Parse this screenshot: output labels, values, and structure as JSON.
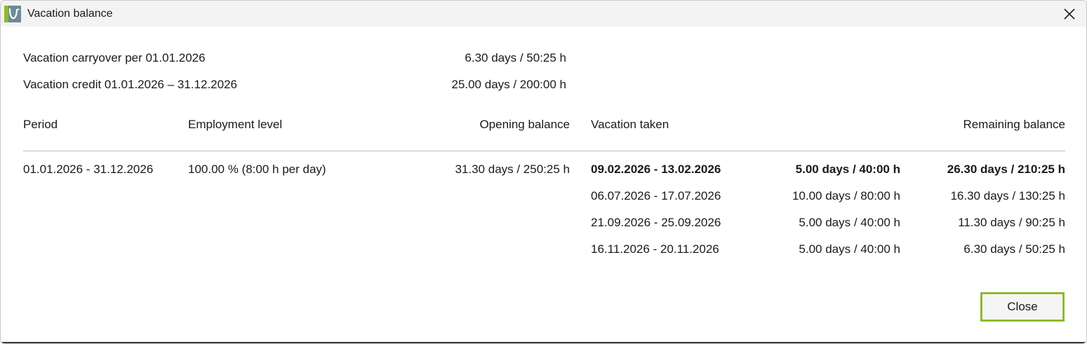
{
  "window": {
    "title": "Vacation balance",
    "accent_color": "#8dba2c"
  },
  "icons": {
    "app": "app-logo-icon",
    "close": "close-icon"
  },
  "summary": {
    "carryover_label": "Vacation carryover per 01.01.2026",
    "carryover_value": "6.30 days / 50:25 h",
    "credit_label": "Vacation credit 01.01.2026 – 31.12.2026",
    "credit_value": "25.00 days / 200:00 h"
  },
  "table": {
    "headers": {
      "period": "Period",
      "employment_level": "Employment level",
      "opening_balance": "Opening balance",
      "vacation_taken": "Vacation taken",
      "remaining_balance": "Remaining balance"
    },
    "row": {
      "period": "01.01.2026 - 31.12.2026",
      "employment_level": "100.00 % (8:00 h per day)",
      "opening_balance": "31.30 days / 250:25 h",
      "vacations": [
        {
          "dates": "09.02.2026 - 13.02.2026",
          "amount": "5.00 days / 40:00 h",
          "remaining": "26.30 days / 210:25 h",
          "highlighted": true
        },
        {
          "dates": "06.07.2026 - 17.07.2026",
          "amount": "10.00 days / 80:00 h",
          "remaining": "16.30 days / 130:25 h",
          "highlighted": false
        },
        {
          "dates": "21.09.2026 - 25.09.2026",
          "amount": "5.00 days / 40:00 h",
          "remaining": "11.30 days / 90:25 h",
          "highlighted": false
        },
        {
          "dates": "16.11.2026 - 20.11.2026",
          "amount": "5.00 days / 40:00 h",
          "remaining": "6.30 days / 50:25 h",
          "highlighted": false
        }
      ]
    }
  },
  "footer": {
    "close_label": "Close"
  }
}
